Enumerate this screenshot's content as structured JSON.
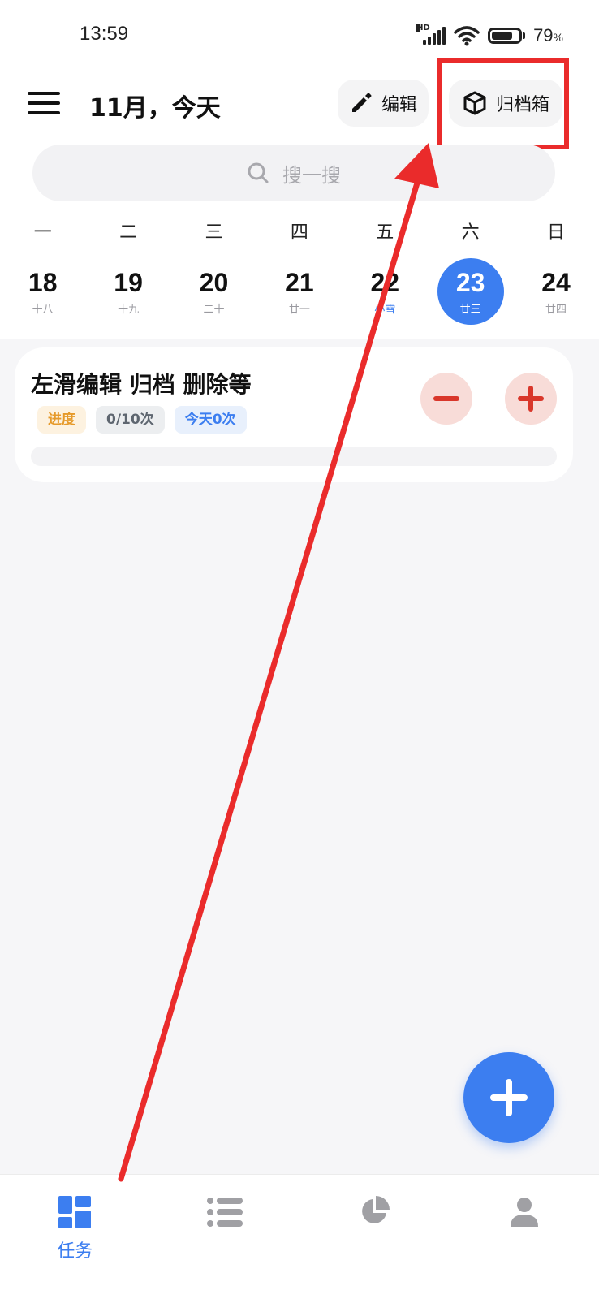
{
  "status_bar": {
    "time": "13:59",
    "hd": "HD",
    "battery_percent": "79",
    "battery_unit": "%",
    "battery_level": 0.79
  },
  "header": {
    "title": "11月，今天",
    "edit_label": "编辑",
    "archive_label": "归档箱"
  },
  "search": {
    "placeholder": "搜一搜"
  },
  "week": {
    "weekdays": [
      "一",
      "二",
      "三",
      "四",
      "五",
      "六",
      "日"
    ],
    "days": [
      {
        "num": "18",
        "lunar": "十八"
      },
      {
        "num": "19",
        "lunar": "十九"
      },
      {
        "num": "20",
        "lunar": "二十"
      },
      {
        "num": "21",
        "lunar": "廿一"
      },
      {
        "num": "22",
        "lunar": "小雪"
      },
      {
        "num": "23",
        "lunar": "廿三"
      },
      {
        "num": "24",
        "lunar": "廿四"
      }
    ]
  },
  "task": {
    "title": "左滑编辑 归档 删除等",
    "tag_progress": "进度",
    "tag_count": "0/10次",
    "tag_today": "今天0次",
    "progress": 0
  },
  "nav": {
    "tasks_label": "任务"
  },
  "colors": {
    "accent": "#3c7ef0",
    "danger": "#d9372b",
    "annotation": "#ea2b2b"
  }
}
